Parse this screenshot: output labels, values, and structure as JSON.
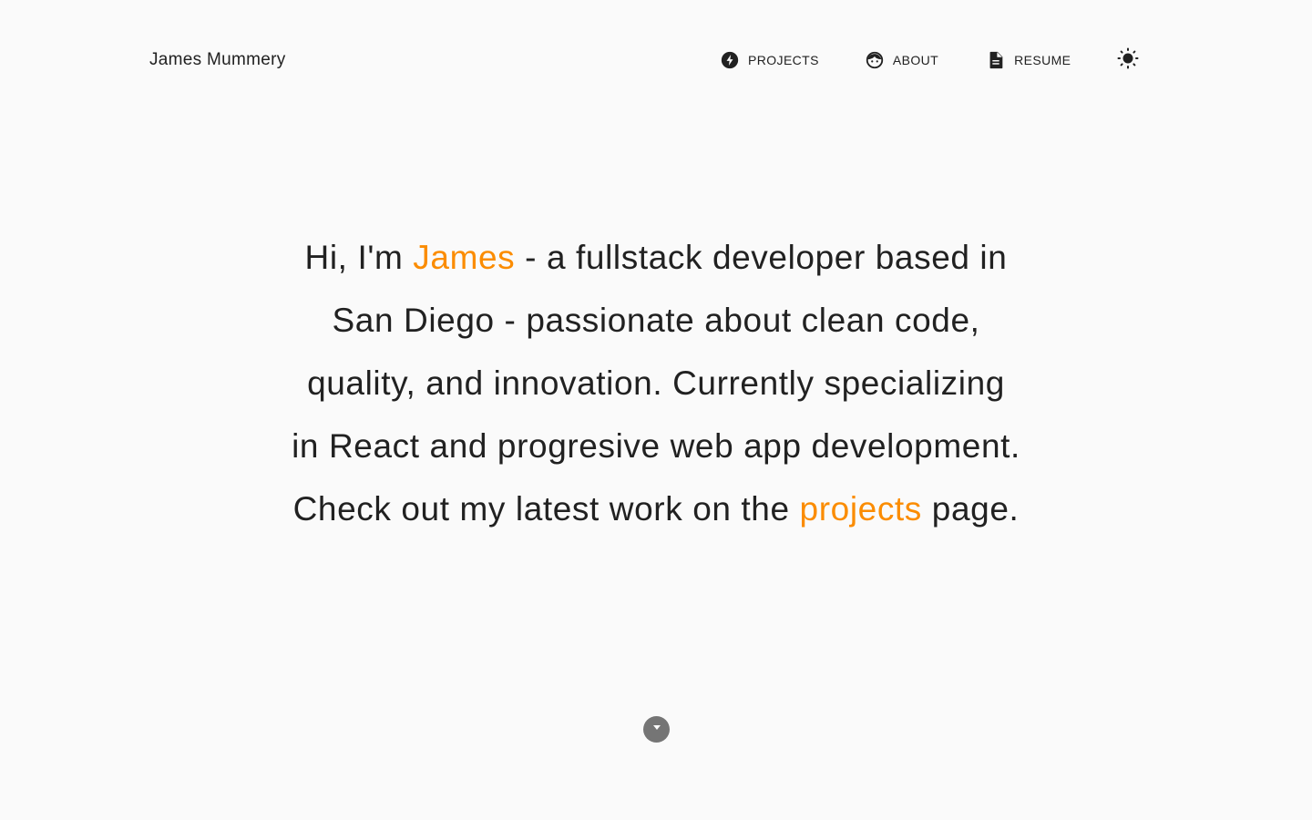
{
  "header": {
    "brand": "James Mummery",
    "nav": [
      {
        "label": "PROJECTS",
        "icon": "bolt-icon"
      },
      {
        "label": "ABOUT",
        "icon": "face-icon"
      },
      {
        "label": "RESUME",
        "icon": "document-icon"
      }
    ],
    "theme_toggle_icon": "sun-icon"
  },
  "hero": {
    "greeting": "Hi, I'm ",
    "name": "James",
    "text_1": " - a fullstack developer based in San Diego - passionate about clean code, quality, and innovation. Currently specializing in React and progresive web app development. Check out my latest work on the ",
    "projects_link": "projects",
    "text_2": " page."
  },
  "scroll_icon": "chevron-down-icon",
  "colors": {
    "background": "#fafafa",
    "text": "#212121",
    "accent": "#fb8c00",
    "scroll_button": "#757575"
  }
}
